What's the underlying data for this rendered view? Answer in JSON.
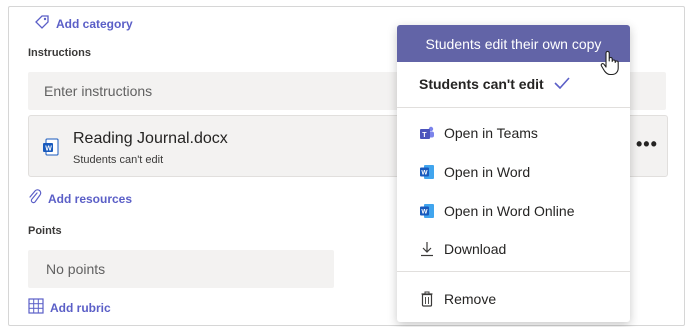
{
  "form": {
    "add_category": "Add category",
    "instructions_label": "Instructions",
    "instructions_placeholder": "Enter instructions",
    "resource": {
      "file_name": "Reading Journal.docx",
      "permission": "Students can't edit"
    },
    "more_label": "•••",
    "add_resources": "Add resources",
    "points_label": "Points",
    "points_value": "No points",
    "add_rubric": "Add rubric"
  },
  "menu": {
    "highlighted_option": "Students edit their own copy",
    "selected_option": "Students can't edit",
    "items": [
      {
        "label": "Open in Teams",
        "icon": "teams-icon"
      },
      {
        "label": "Open in Word",
        "icon": "word-icon"
      },
      {
        "label": "Open in Word Online",
        "icon": "word-online-icon"
      },
      {
        "label": "Download",
        "icon": "download-icon"
      }
    ],
    "remove_label": "Remove"
  },
  "colors": {
    "accent": "#6264a7",
    "link": "#5b5fc7",
    "word_blue": "#185abd"
  }
}
